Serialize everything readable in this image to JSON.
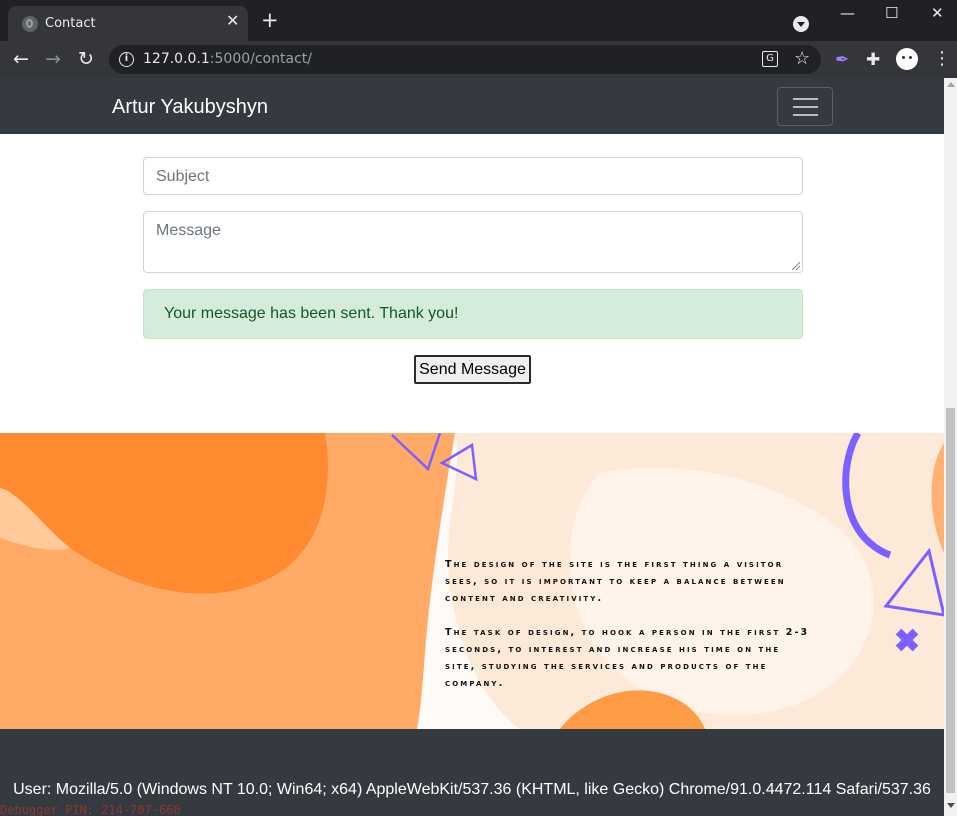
{
  "browser": {
    "tab_title": "Contact",
    "tab_close": "✕",
    "new_tab": "+",
    "url_host": "127.0.0.1",
    "url_rest": ":5000/contact/",
    "window_controls": {
      "minimize": "—",
      "maximize": "☐",
      "close": "✕"
    }
  },
  "site": {
    "brand": "Artur Yakubyshyn"
  },
  "form": {
    "subject_placeholder": "Subject",
    "message_placeholder": "Message",
    "alert": "Your message has been sent. Thank you!",
    "send_label": "Send Message"
  },
  "banner": {
    "paragraph_1": "The design of the site is the first thing a visitor sees, so it is important to keep a balance between content and creativity.",
    "paragraph_2": "The task of design, to hook a person in the first 2-3 seconds, to interest and increase his time on the site, studying the services and products of the company."
  },
  "footer": {
    "user_agent": "User: Mozilla/5.0 (Windows NT 10.0; Win64; x64) AppleWebKit/537.36 (KHTML, like Gecko) Chrome/91.0.4472.114 Safari/537.36",
    "debugger": "Debugger PIN: 214-707-660"
  },
  "colors": {
    "navbar": "#343a40",
    "alert_bg": "#d4edda",
    "alert_text": "#155724",
    "banner_orange": "#ff9f4f",
    "banner_purple": "#7b61ff"
  }
}
